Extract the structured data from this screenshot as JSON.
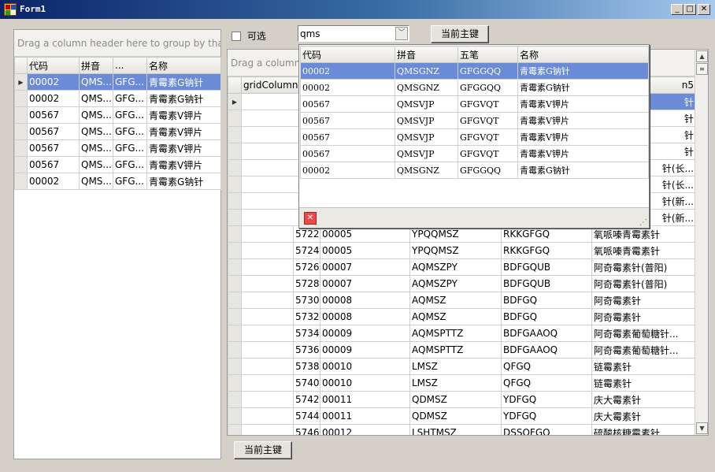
{
  "window": {
    "title": "Form1",
    "min": "_",
    "max": "□",
    "close": "✕"
  },
  "filter": {
    "checkbox_label": "可选",
    "checked": false
  },
  "search": {
    "value": "qms",
    "dropdown_arrow": "﹀"
  },
  "buttons": {
    "top_pk": "当前主键",
    "bottom_pk": "当前主键"
  },
  "left_grid": {
    "group_hint": "Drag a column header here to group by that c",
    "columns": [
      "代码",
      "拼音",
      "...",
      "名称"
    ],
    "rows": [
      [
        "00002",
        "QMS...",
        "GFG...",
        "青霉素G钠针"
      ],
      [
        "00002",
        "QMS...",
        "GFG...",
        "青霉素G钠针"
      ],
      [
        "00567",
        "QMS...",
        "GFG...",
        "青霉素V钾片"
      ],
      [
        "00567",
        "QMS...",
        "GFG...",
        "青霉素V钾片"
      ],
      [
        "00567",
        "QMS...",
        "GFG...",
        "青霉素V钾片"
      ],
      [
        "00567",
        "QMS...",
        "GFG...",
        "青霉素V钾片"
      ],
      [
        "00002",
        "QMS...",
        "GFG...",
        "青霉素G钠针"
      ]
    ],
    "selected_row": 0
  },
  "popup": {
    "columns": [
      "代码",
      "拼音",
      "五笔",
      "名称"
    ],
    "rows": [
      [
        "00002",
        "QMSGNZ",
        "GFGGQQ",
        "青霉素G钠针"
      ],
      [
        "00002",
        "QMSGNZ",
        "GFGGQQ",
        "青霉素G钠针"
      ],
      [
        "00567",
        "QMSVJP",
        "GFGVQT",
        "青霉素V钾片"
      ],
      [
        "00567",
        "QMSVJP",
        "GFGVQT",
        "青霉素V钾片"
      ],
      [
        "00567",
        "QMSVJP",
        "GFGVQT",
        "青霉素V钾片"
      ],
      [
        "00567",
        "QMSVJP",
        "GFGVQT",
        "青霉素V钾片"
      ],
      [
        "00002",
        "QMSGNZ",
        "GFGGQQ",
        "青霉素G钠针"
      ]
    ],
    "selected_row": 0,
    "close_icon": "✕",
    "grip_icon": "⋰"
  },
  "main_grid": {
    "group_hint": "Drag a column h",
    "columns": [
      "gridColumn1",
      "",
      "",
      "",
      "n5"
    ],
    "rows_hidden": [
      [
        "",
        "",
        "",
        "",
        "针"
      ],
      [
        "",
        "",
        "",
        "",
        "针"
      ],
      [
        "",
        "",
        "",
        "",
        "针"
      ],
      [
        "",
        "",
        "",
        "",
        "针"
      ],
      [
        "",
        "",
        "",
        "",
        "针(长..."
      ],
      [
        "",
        "",
        "",
        "",
        "针(长..."
      ],
      [
        "",
        "",
        "",
        "",
        "针(新..."
      ],
      [
        "",
        "",
        "",
        "",
        "针(新..."
      ]
    ],
    "rows": [
      [
        "",
        "5722",
        "00005",
        "YPQQMSZ",
        "RKKGFGQ",
        "氧哌嗪青霉素针"
      ],
      [
        "",
        "5724",
        "00005",
        "YPQQMSZ",
        "RKKGFGQ",
        "氧哌嗪青霉素针"
      ],
      [
        "",
        "5726",
        "00007",
        "AQMSZPY",
        "BDFGQUB",
        "阿奇霉素针(普阳)"
      ],
      [
        "",
        "5728",
        "00007",
        "AQMSZPY",
        "BDFGQUB",
        "阿奇霉素针(普阳)"
      ],
      [
        "",
        "5730",
        "00008",
        "AQMSZ",
        "BDFGQ",
        "阿奇霉素针"
      ],
      [
        "",
        "5732",
        "00008",
        "AQMSZ",
        "BDFGQ",
        "阿奇霉素针"
      ],
      [
        "",
        "5734",
        "00009",
        "AQMSPTTZ",
        "BDFGAAOQ",
        "阿奇霉素葡萄糖针..."
      ],
      [
        "",
        "5736",
        "00009",
        "AQMSPTTZ",
        "BDFGAAOQ",
        "阿奇霉素葡萄糖针..."
      ],
      [
        "",
        "5738",
        "00010",
        "LMSZ",
        "QFGQ",
        "链霉素针"
      ],
      [
        "",
        "5740",
        "00010",
        "LMSZ",
        "QFGQ",
        "链霉素针"
      ],
      [
        "",
        "5742",
        "00011",
        "QDMSZ",
        "YDFGQ",
        "庆大霉素针"
      ],
      [
        "",
        "5744",
        "00011",
        "QDMSZ",
        "YDFGQ",
        "庆大霉素针"
      ],
      [
        "",
        "5746",
        "00012",
        "LSHTMSZ",
        "DSSOFGQ",
        "硫酸核糖霉素针"
      ]
    ]
  }
}
